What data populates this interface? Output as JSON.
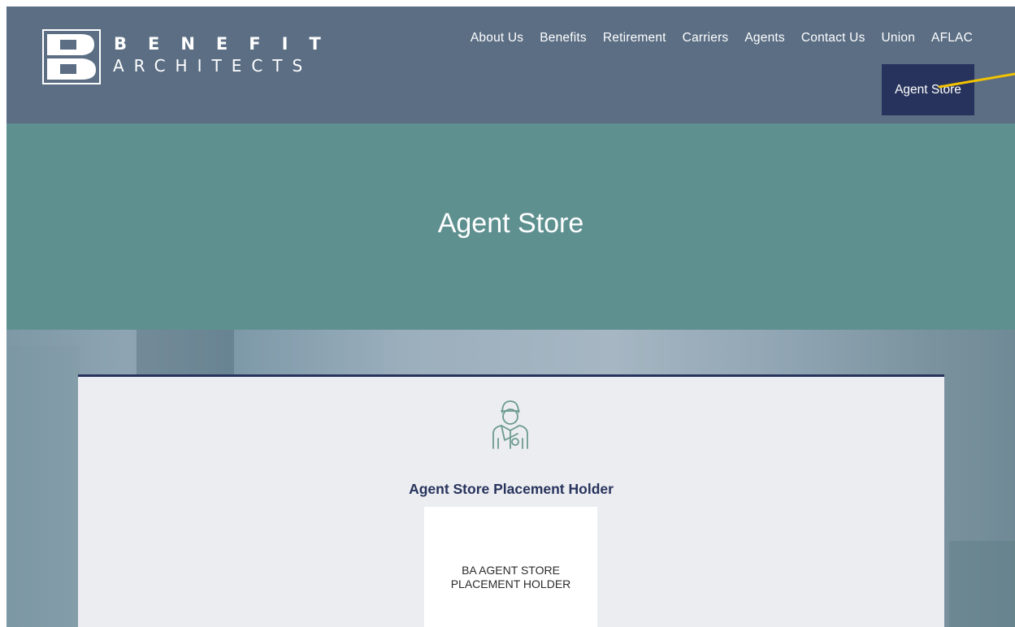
{
  "brand": {
    "word1": "BENEFIT",
    "word2": "ARCHITECTS"
  },
  "nav": {
    "items": [
      "About Us",
      "Benefits",
      "Retirement",
      "Carriers",
      "Agents",
      "Contact Us",
      "Union",
      "AFLAC"
    ],
    "active": "Agent Store"
  },
  "hero": {
    "title": "Agent Store"
  },
  "card": {
    "icon": "agent-person-icon",
    "title": "Agent Store Placement Holder",
    "placeholder_line1": "BA AGENT STORE",
    "placeholder_line2": "PLACEMENT HOLDER"
  },
  "colors": {
    "header": "#5b6e84",
    "hero": "#5f9090",
    "accent_navy": "#27335c",
    "annotation_arrow": "#f2c200",
    "card": "#ecedf1",
    "icon_stroke": "#6b9a90"
  }
}
